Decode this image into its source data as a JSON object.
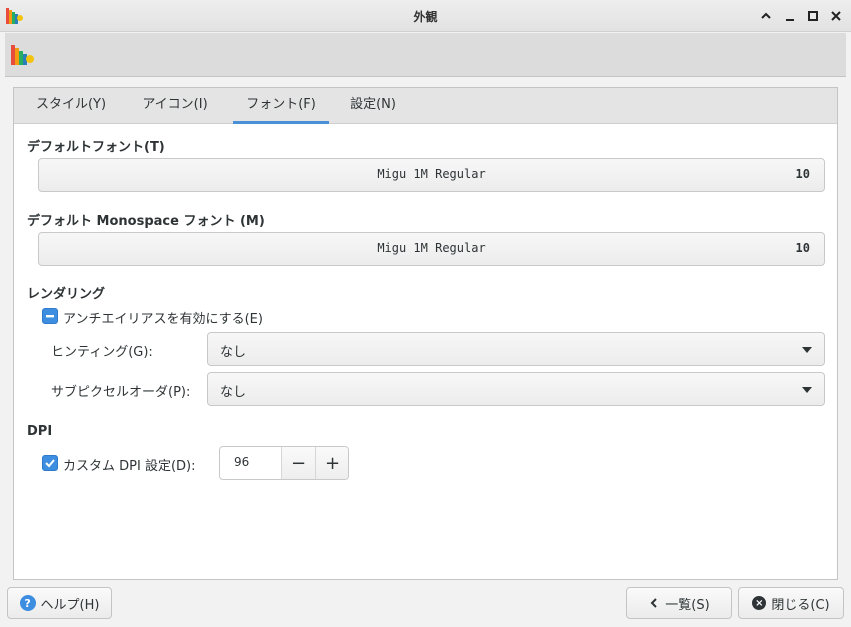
{
  "window": {
    "title": "外観"
  },
  "tabs": [
    {
      "label": "スタイル(Y)"
    },
    {
      "label": "アイコン(I)"
    },
    {
      "label": "フォント(F)"
    },
    {
      "label": "設定(N)"
    }
  ],
  "fonts": {
    "default_label": "デフォルトフォント(T)",
    "default_name": "Migu 1M Regular",
    "default_size": "10",
    "mono_label": "デフォルト Monospace フォント (M)",
    "mono_name": "Migu 1M Regular",
    "mono_size": "10"
  },
  "rendering": {
    "title": "レンダリング",
    "antialias_label": "アンチエイリアスを有効にする(E)",
    "hinting_label": "ヒンティング(G):",
    "hinting_value": "なし",
    "subpixel_label": "サブピクセルオーダ(P):",
    "subpixel_value": "なし"
  },
  "dpi": {
    "title": "DPI",
    "custom_label": "カスタム DPI 設定(D):",
    "value": "96",
    "minus": "−",
    "plus": "+"
  },
  "buttons": {
    "help": "ヘルプ(H)",
    "overview": "一覧(S)",
    "close": "閉じる(C)"
  },
  "colors": {
    "accent": "#4a90d9",
    "checkbox": "#3d8ee0"
  }
}
